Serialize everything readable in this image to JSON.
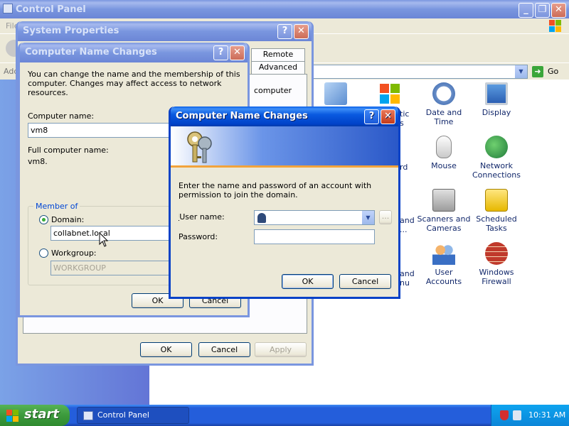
{
  "control_panel": {
    "title": "Control Panel",
    "menu_file": "File",
    "address_label": "Address",
    "go_label": "Go",
    "icons": [
      {
        "label": "Date and Time",
        "icon": "clock-icon"
      },
      {
        "label": "Display",
        "icon": "display-icon"
      },
      {
        "label": "Mouse",
        "icon": "mouse-icon"
      },
      {
        "label": "Network Connections",
        "icon": "network-icon"
      },
      {
        "label": "Scanners and Cameras",
        "icon": "scanner-icon"
      },
      {
        "label": "Scheduled Tasks",
        "icon": "tasks-icon"
      },
      {
        "label": "User Accounts",
        "icon": "users-icon"
      },
      {
        "label": "Windows Firewall",
        "icon": "firewall-icon"
      }
    ],
    "partial_labels": [
      "tic",
      "s",
      "rd",
      "and",
      "...",
      "and",
      "nu"
    ]
  },
  "system_properties": {
    "title": "System Properties",
    "tabs": [
      "Remote",
      "Advanced"
    ],
    "body_fragment": "computer",
    "ok": "OK",
    "cancel": "Cancel",
    "apply": "Apply"
  },
  "cnc_back": {
    "title": "Computer Name Changes",
    "intro": "You can change the name and the membership of this computer. Changes may affect access to network resources.",
    "computer_name_label": "Computer name:",
    "computer_name_value": "vm8",
    "full_name_label": "Full computer name:",
    "full_name_value": "vm8.",
    "member_of_label": "Member of",
    "domain_label": "Domain:",
    "domain_value": "collabnet.local",
    "workgroup_label": "Workgroup:",
    "workgroup_value": "WORKGROUP",
    "ok": "OK",
    "cancel": "Cancel"
  },
  "cnc_front": {
    "title": "Computer Name Changes",
    "message": "Enter the name and password of an account with permission to join the domain.",
    "username_label": "User name:",
    "password_label": "Password:",
    "browse_label": "...",
    "ok": "OK",
    "cancel": "Cancel"
  },
  "taskbar": {
    "start": "start",
    "task_button": "Control Panel",
    "time": "10:31 AM"
  }
}
